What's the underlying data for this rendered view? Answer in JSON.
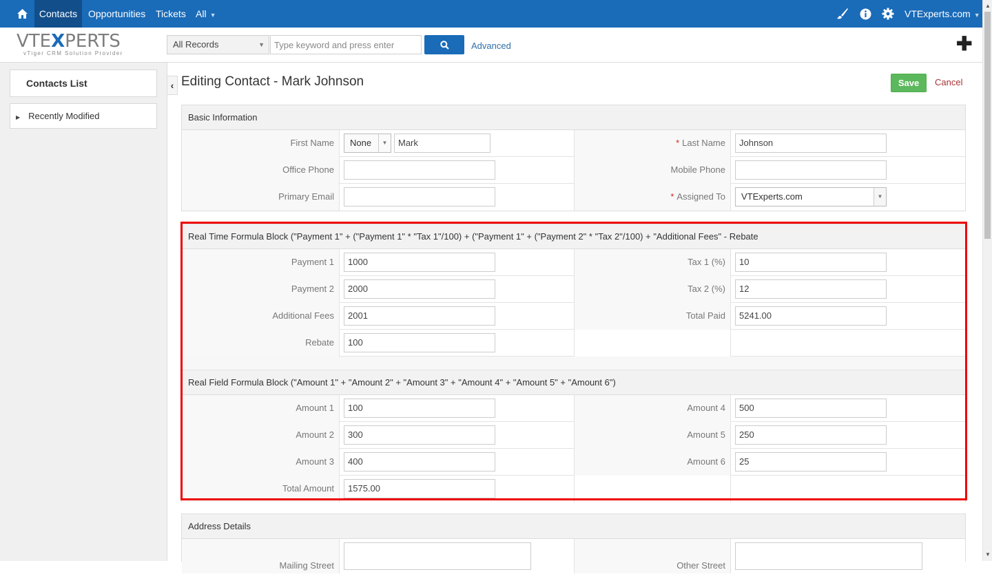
{
  "topnav": {
    "items": [
      "Contacts",
      "Opportunities",
      "Tickets",
      "All"
    ],
    "user": "VTExperts.com"
  },
  "header": {
    "logo": "VTEXPERTS",
    "logo_sub": "vTiger CRM Solution Provider",
    "record_filter": "All Records",
    "search_placeholder": "Type keyword and press enter",
    "advanced_label": "Advanced"
  },
  "sidebar": {
    "title": "Contacts List",
    "items": [
      "Recently Modified"
    ]
  },
  "main": {
    "title": "Editing Contact - Mark Johnson",
    "save_label": "Save",
    "cancel_label": "Cancel"
  },
  "basic": {
    "title": "Basic Information",
    "first_name_label": "First Name",
    "salutation": "None",
    "first_name": "Mark",
    "last_name_label": "Last Name",
    "last_name": "Johnson",
    "office_phone_label": "Office Phone",
    "office_phone": "",
    "mobile_phone_label": "Mobile Phone",
    "mobile_phone": "",
    "primary_email_label": "Primary Email",
    "primary_email": "",
    "assigned_to_label": "Assigned To",
    "assigned_to": "VTExperts.com"
  },
  "realtime": {
    "title": "Real Time Formula Block (\"Payment 1\" + (\"Payment 1\" * \"Tax 1\"/100) + (\"Payment 1\" + (\"Payment 2\" * \"Tax 2\"/100) + \"Additional Fees\" - Rebate",
    "payment1_label": "Payment 1",
    "payment1": "1000",
    "tax1_label": "Tax 1 (%)",
    "tax1": "10",
    "payment2_label": "Payment 2",
    "payment2": "2000",
    "tax2_label": "Tax 2 (%)",
    "tax2": "12",
    "fees_label": "Additional Fees",
    "fees": "2001",
    "total_paid_label": "Total Paid",
    "total_paid": "5241.00",
    "rebate_label": "Rebate",
    "rebate": "100"
  },
  "realfield": {
    "title": "Real Field Formula Block (\"Amount 1\" + \"Amount 2\" + \"Amount 3\" + \"Amount 4\" + \"Amount 5\" + \"Amount 6\")",
    "amount1_label": "Amount 1",
    "amount1": "100",
    "amount4_label": "Amount 4",
    "amount4": "500",
    "amount2_label": "Amount 2",
    "amount2": "300",
    "amount5_label": "Amount 5",
    "amount5": "250",
    "amount3_label": "Amount 3",
    "amount3": "400",
    "amount6_label": "Amount 6",
    "amount6": "25",
    "total_amount_label": "Total Amount",
    "total_amount": "1575.00"
  },
  "address": {
    "title": "Address Details",
    "mailing_street_label": "Mailing Street",
    "other_street_label": "Other Street"
  },
  "colors": {
    "nav": "#1a6bb8",
    "save": "#5cb85c",
    "highlight": "#e00000"
  }
}
